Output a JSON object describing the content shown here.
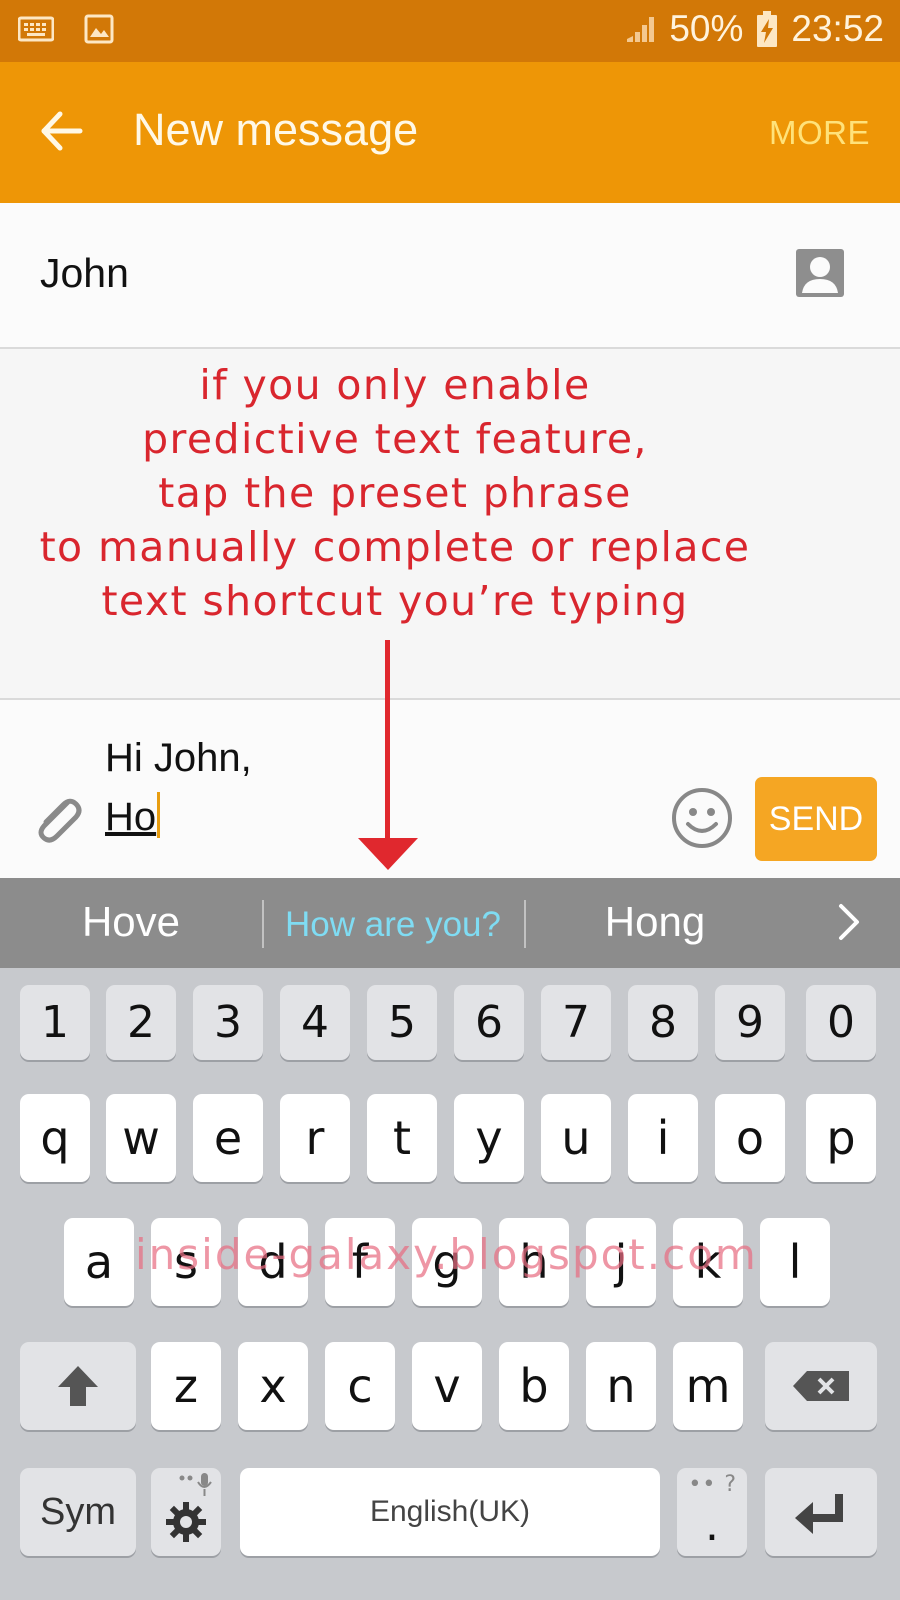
{
  "status_bar": {
    "battery": "50%",
    "time": "23:52"
  },
  "app_bar": {
    "title": "New message",
    "more_label": "MORE"
  },
  "recipient": {
    "name": "John"
  },
  "annotation": {
    "lines": [
      "if you only enable",
      "predictive text feature,",
      "tap the preset phrase",
      "to manually complete or replace",
      "text shortcut you’re typing"
    ]
  },
  "composer": {
    "line1": "Hi John,",
    "line2": "Ho",
    "send_label": "SEND"
  },
  "suggestions": [
    "Hove",
    "How are you?",
    "Hong"
  ],
  "keyboard": {
    "numbers": [
      "1",
      "2",
      "3",
      "4",
      "5",
      "6",
      "7",
      "8",
      "9",
      "0"
    ],
    "row1": [
      "q",
      "w",
      "e",
      "r",
      "t",
      "y",
      "u",
      "i",
      "o",
      "p"
    ],
    "row2": [
      "a",
      "s",
      "d",
      "f",
      "g",
      "h",
      "j",
      "k",
      "l"
    ],
    "row3": [
      "z",
      "x",
      "c",
      "v",
      "b",
      "n",
      "m"
    ],
    "sym_label": "Sym",
    "space_label": "English(UK)",
    "period_label": ".",
    "period_hint": "?"
  },
  "watermark": "inside-galaxy.blogspot.com",
  "colors": {
    "status_bar": "#d27807",
    "app_bar": "#ee9606",
    "send": "#f5a623",
    "annotation": "#d9262e",
    "suggestion_highlight": "#7fdcf3"
  }
}
